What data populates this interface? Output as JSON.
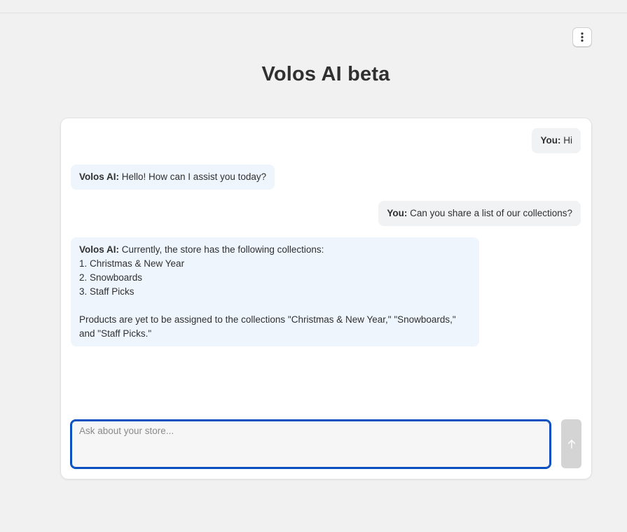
{
  "page": {
    "title": "Volos AI beta"
  },
  "menu": {
    "icon": "more-vertical-icon"
  },
  "chat": {
    "messages": [
      {
        "role": "user",
        "speaker": "You:",
        "text": "Hi"
      },
      {
        "role": "ai",
        "speaker": "Volos AI:",
        "text": "Hello! How can I assist you today?"
      },
      {
        "role": "user",
        "speaker": "You:",
        "text": "Can you share a list of our collections?"
      },
      {
        "role": "ai",
        "speaker": "Volos AI:",
        "text": "Currently, the store has the following collections:",
        "list": [
          "1. Christmas & New Year",
          "2. Snowboards",
          "3. Staff Picks"
        ],
        "footer": "Products are yet to be assigned to the collections \"Christmas & New Year,\" \"Snowboards,\" and \"Staff Picks.\""
      }
    ]
  },
  "composer": {
    "placeholder": "Ask about your store...",
    "value": "",
    "send_icon": "arrow-up-icon"
  },
  "colors": {
    "accent": "#0a4fbf",
    "ai_bubble": "#eef5fd",
    "user_bubble": "#f1f2f4",
    "send_disabled": "#d4d4d4"
  }
}
